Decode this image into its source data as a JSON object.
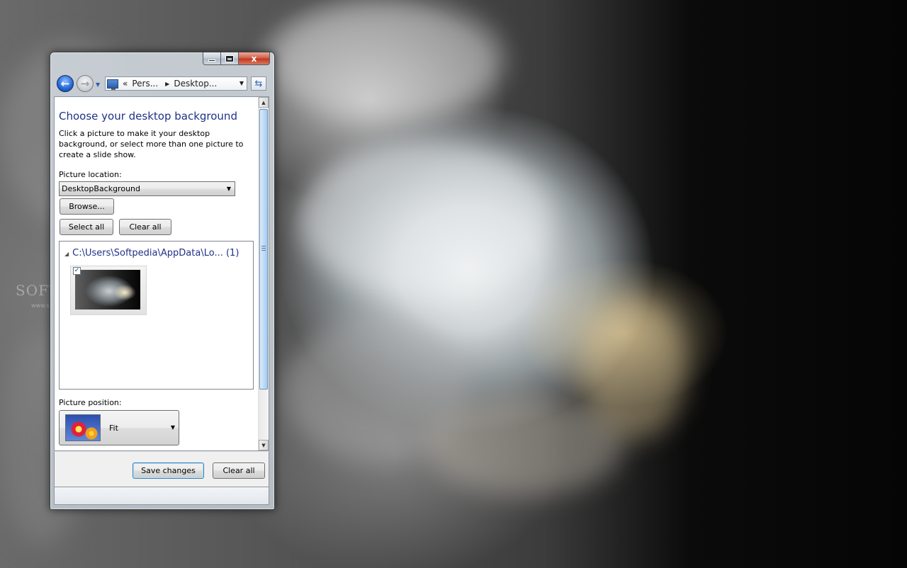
{
  "window": {
    "close_glyph": "x",
    "back_glyph": "←",
    "forward_glyph": "→",
    "address": {
      "overflow": "«",
      "crumbs": [
        "Pers...",
        "Desktop..."
      ]
    }
  },
  "page": {
    "title": "Choose your desktop background",
    "description": "Click a picture to make it your desktop background, or select more than one picture to create a slide show."
  },
  "picture_location": {
    "label": "Picture location:",
    "value": "DesktopBackground",
    "browse_label": "Browse..."
  },
  "selection": {
    "select_all_label": "Select all",
    "clear_all_label": "Clear all"
  },
  "gallery": {
    "group_label": "C:\\Users\\Softpedia\\AppData\\Lo... (1)",
    "items": [
      {
        "checked": true
      }
    ]
  },
  "picture_position": {
    "label": "Picture position:",
    "value": "Fit"
  },
  "footer": {
    "save_label": "Save changes",
    "clear_label": "Clear all"
  },
  "watermark": {
    "text": "SOFTPEDIA",
    "url": "www.softpedia.com"
  },
  "colors": {
    "title_blue": "#1e3287",
    "accent_blue": "#2266d1"
  }
}
